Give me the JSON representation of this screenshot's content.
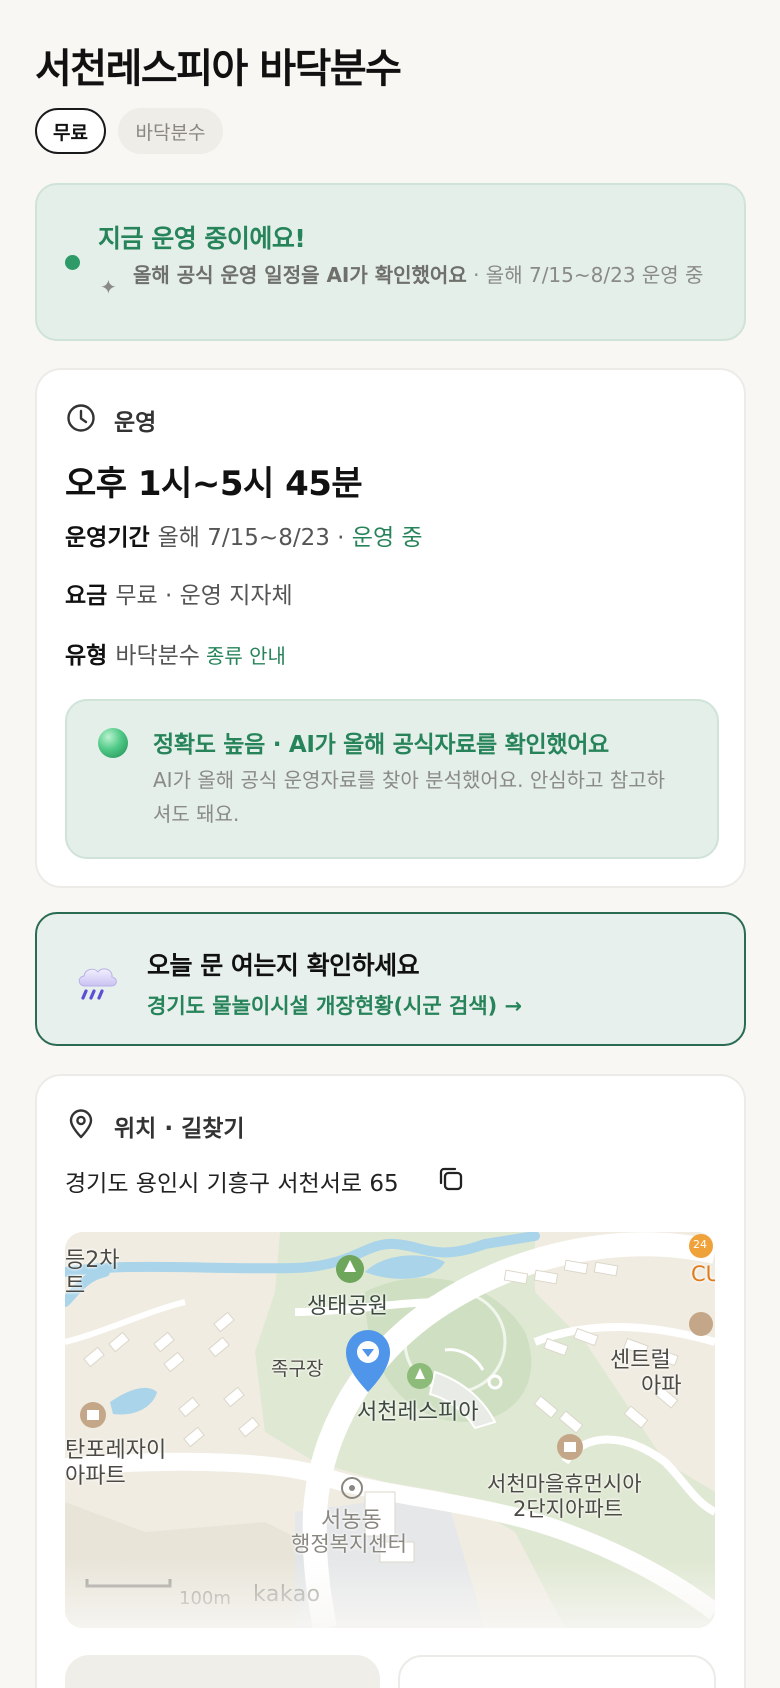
{
  "place": {
    "title": "서천레스피아 바닥분수",
    "chips": {
      "price": "무료",
      "type": "바닥분수"
    }
  },
  "status": {
    "title": "지금 운영 중이에요!",
    "desc_bold": "올해 공식 운영 일정을 AI가 확인했어요",
    "desc_rest": " · 올해 7/15~8/23 운영 중",
    "dot_color": "#2d9a68",
    "icon": "sparkle-icon"
  },
  "operation": {
    "section_label": "운영",
    "section_icon": "clock-icon",
    "hours": "오후 1시~5시 45분",
    "period_key": "운영기간",
    "period_value": "올해 7/15~8/23 · ",
    "period_status": "운영 중",
    "fee_key": "요금",
    "fee_value": "무료 · 운영 지자체",
    "type_key": "유형",
    "type_value": "바닥분수",
    "type_link": "종류 안내",
    "accuracy": {
      "title": "정확도 높음 · AI가 올해 공식자료를 확인했어요",
      "desc": "AI가 올해 공식 운영자료를 찾아 분석했어요. 안심하고 참고하셔도 돼요."
    }
  },
  "cta": {
    "icon": "rain-cloud-icon",
    "title": "오늘 문 여는지 확인하세요",
    "link": "경기도 물놀이시설 개장현황(시군 검색) →"
  },
  "location": {
    "section_label": "위치 · 길찾기",
    "section_icon": "map-pin-icon",
    "address": "경기도 용인시 기흥구 서천서로 65",
    "copy_icon": "copy-icon",
    "map": {
      "labels": {
        "park": "생태공원",
        "foot": "족구장",
        "respia": "서천레스피아",
        "center_line1": "센트럴",
        "center_line2": "아파",
        "tanpo_line1": "탄포레자이",
        "tanpo_line2": "아파트",
        "seocheon_line1": "서천마을휴먼시아",
        "seocheon_line2": "2단지아파트",
        "seonong_line1": "서농동",
        "seonong_line2": "행정복지센터",
        "top_left_line1": "등2차",
        "top_left_line2": "트",
        "cu": "CU",
        "badge24": "24"
      },
      "scale": "100m",
      "brand": "kakao"
    }
  }
}
